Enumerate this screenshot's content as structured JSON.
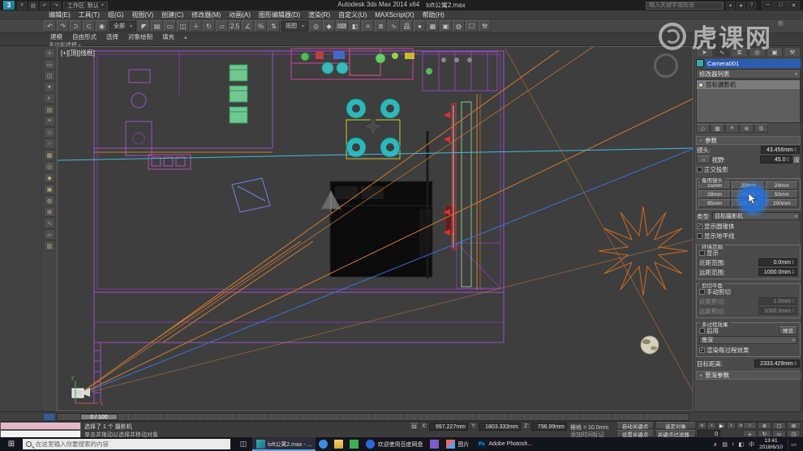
{
  "colors": {
    "selection_blue": "#2a5db0",
    "taskbar_accent": "#5aa7e0",
    "wire_orange": "#cf7a2e",
    "wire_purple": "#9950c8",
    "teal_object": "#2fb8b8",
    "cursor_highlight": "#2373e1"
  },
  "title_bar": {
    "logo": "3",
    "quick_icons": [
      "≡",
      "▤",
      "↶",
      "↷"
    ],
    "workspace": "工作区: 默认",
    "app_title": "Autodesk 3ds Max 2014 x64",
    "file_name": "loft公寓2.max",
    "search_placeholder": "输入关键字或短语",
    "info_icons": [
      "▾",
      "★",
      "?"
    ],
    "min": "─",
    "max": "□",
    "close": "✕"
  },
  "menu": {
    "items": [
      "编辑(E)",
      "工具(T)",
      "组(G)",
      "视图(V)",
      "创建(C)",
      "修改器(M)",
      "动画(A)",
      "图形编辑器(D)",
      "渲染(R)",
      "自定义(U)",
      "MAXScript(X)",
      "帮助(H)"
    ]
  },
  "toolbar": {
    "icons_a": [
      "↶",
      "↷",
      "⊃",
      "⊂",
      "◉"
    ],
    "filter": "全部",
    "icons_b": [
      "◤",
      "▤",
      "▭",
      "◫",
      "＋",
      "↻",
      "▱",
      "2.5",
      "∠",
      "%",
      "⇅"
    ],
    "coord": "视图",
    "icons_c": [
      "◎",
      "◆",
      "⌨",
      "◧",
      "≡",
      "≣",
      "∿",
      "品",
      "●",
      "▦",
      "▣",
      "◍",
      "☐",
      "⚒"
    ]
  },
  "ribbon": {
    "tabs": [
      "建模",
      "自由形式",
      "选择",
      "对象绘制",
      "填充"
    ],
    "collapse": "▴",
    "panel_label": "多边形建模"
  },
  "left_toolbar": {
    "icons": [
      "＋",
      "▭",
      "◫",
      "●",
      "◐",
      "▤",
      "≡",
      "◇",
      "○",
      "▦",
      "◎",
      "◆",
      "▣",
      "◍",
      "⊞",
      "∿",
      "▱",
      "▥"
    ]
  },
  "viewport": {
    "label": "[+][顶][线框]",
    "axis_x": "x",
    "axis_y": "y"
  },
  "panel": {
    "tabs": [
      "➤",
      "∿",
      "≣",
      "◎",
      "▣",
      "⚒"
    ],
    "object_name": "Camera001",
    "modifier_list": "修改器列表",
    "stack_item": "目标摄影机",
    "stack_tools": [
      "◇",
      "▦",
      "≡",
      "⊗",
      "⚙"
    ],
    "rollout_params": "参数",
    "lens_label": "镜头:",
    "lens_value": "43.456mm",
    "fov_dir": "↔",
    "fov_label": "视野:",
    "fov_value": "45.0",
    "fov_unit": "度",
    "ortho_label": "正交投影",
    "stock_label": "备用镜头",
    "lens_buttons": [
      "15mm",
      "20mm",
      "24mm",
      "28mm",
      "35mm",
      "50mm",
      "85mm",
      "135mm",
      "200mm"
    ],
    "type_label": "类型:",
    "type_value": "目标摄影机",
    "show_cone": "显示圆锥体",
    "show_horizon": "显示地平线",
    "env_group": "环境范围",
    "env_show": "显示",
    "near_range_label": "近距范围:",
    "near_range_value": "0.0mm",
    "far_range_label": "远距范围:",
    "far_range_value": "1000.0mm",
    "clip_group": "剪切平面",
    "manual_clip": "手动剪切",
    "near_clip_label": "近距剪切:",
    "near_clip_value": "1.0mm",
    "far_clip_label": "远距剪切:",
    "far_clip_value": "1000.0mm",
    "multipass_group": "多过程效果",
    "enable_label": "启用",
    "preview_label": "预览",
    "effect_value": "景深",
    "render_each": "渲染每过程效果",
    "target_label": "目标距离:",
    "target_value": "2333.429mm",
    "rollout_dof": "景深参数"
  },
  "timeline": {
    "handle": "0 / 100"
  },
  "status": {
    "selection": "选择了 1 个 摄影机",
    "prompt": "单击并拖动以选择并移动对象",
    "lock": "⊡",
    "x_label": "X:",
    "x": "997.227mm",
    "y_label": "Y:",
    "y": "1803.333mm",
    "z_label": "Z:",
    "z": "796.99mm",
    "grid": "栅格 = 10.0mm",
    "time_tag": "添加时间标记",
    "auto_key": "自动关键点",
    "set_key": "设置关键点",
    "selected_filter": "选定对象",
    "key_filters": "关键点过滤器...",
    "frame": "0",
    "play": [
      "«",
      "‹",
      "▶",
      "›",
      "»"
    ],
    "nav": [
      "○",
      "⊕",
      "▢",
      "⊞",
      "＋",
      "↻",
      "▭",
      "◳"
    ]
  },
  "taskbar": {
    "start": "⊞",
    "search_placeholder": "在这里输入你要搜索的内容",
    "taskview": "◫",
    "windows": [
      {
        "label": "loft公寓2.max - ..."
      },
      {
        "label": "欢迎使用百度网盘"
      },
      {
        "label": "图片"
      },
      {
        "label": "Adobe Photosh..."
      }
    ],
    "ps_label": "Ps",
    "tray_chevron": "∧",
    "tray_icons": [
      "▤",
      "♪",
      "◧"
    ],
    "ime": "中",
    "time": "13:41",
    "date": "2018/6/10",
    "notif": "▭"
  },
  "watermark": {
    "text": "虎课网",
    "reg": "®"
  }
}
